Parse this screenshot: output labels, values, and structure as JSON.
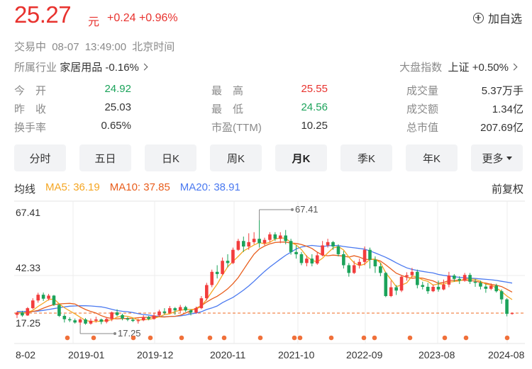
{
  "header": {
    "price": "25.27",
    "unit": "元",
    "change": "+0.24",
    "change_pct": "+0.96%",
    "add_watch": "加自选",
    "status": "交易中",
    "datetime": "08-07 13:49:00",
    "timezone": "北京时间",
    "industry_label": "所属行业",
    "industry_value": "家居用品 -0.16%",
    "market_label": "大盘指数",
    "market_value": "上证 +0.50%"
  },
  "quotes": [
    {
      "label": "今　开",
      "value": "24.92",
      "color": "#1ba35a"
    },
    {
      "label": "昨　收",
      "value": "25.03",
      "color": "#333333"
    },
    {
      "label": "换手率",
      "value": "0.65%",
      "color": "#333333"
    },
    {
      "label": "最　高",
      "value": "25.55",
      "color": "#e8322e"
    },
    {
      "label": "最　低",
      "value": "24.56",
      "color": "#1ba35a"
    },
    {
      "label": "市盈(TTM)",
      "value": "10.25",
      "color": "#333333"
    },
    {
      "label": "成交量",
      "value": "5.37万手",
      "color": "#333333"
    },
    {
      "label": "成交额",
      "value": "1.34亿",
      "color": "#333333"
    },
    {
      "label": "总市值",
      "value": "207.69亿",
      "color": "#333333"
    }
  ],
  "tabs": [
    "分时",
    "五日",
    "日K",
    "周K",
    "月K",
    "季K",
    "年K",
    "更多"
  ],
  "active_tab": "月K",
  "ma": {
    "label": "均线",
    "ma5": "MA5: 36.19",
    "ma10": "MA10: 37.85",
    "ma20": "MA20: 38.91",
    "ma5_color": "#f5a623",
    "ma10_color": "#e85d1c",
    "ma20_color": "#4a79f0"
  },
  "adjust": "前复权",
  "chart_data": {
    "type": "candlestick",
    "y_ticks": [
      "67.41",
      "42.33",
      "17.25"
    ],
    "ylim": [
      17.25,
      67.41
    ],
    "x_ticks": [
      "8-02",
      "2019-01",
      "2019-12",
      "2020-11",
      "2021-10",
      "2022-09",
      "2023-08",
      "2024-08"
    ],
    "max_label": "67.41",
    "min_label": "17.25",
    "last_close": 25.27,
    "up_color": "#f23d3d",
    "down_color": "#1ba35a",
    "candles": [
      [
        24.5,
        25.5,
        23,
        26
      ],
      [
        25.5,
        24.2,
        23.6,
        26.3
      ],
      [
        24.2,
        27.5,
        24,
        28
      ],
      [
        27.5,
        31,
        27,
        32
      ],
      [
        31,
        33.6,
        30,
        34.5
      ],
      [
        33.6,
        31.8,
        30.8,
        34.6
      ],
      [
        31.8,
        33.2,
        31,
        34
      ],
      [
        33.2,
        29,
        28.5,
        33.5
      ],
      [
        29,
        24,
        23.5,
        29.5
      ],
      [
        24,
        22.5,
        21,
        24.8
      ],
      [
        22.5,
        22,
        21.2,
        23.4
      ],
      [
        22,
        21,
        20.5,
        22.8
      ],
      [
        21,
        22.4,
        19.8,
        23
      ],
      [
        22.4,
        20.5,
        20,
        23
      ],
      [
        20.5,
        21.8,
        20,
        22.8
      ],
      [
        21.8,
        22.4,
        21,
        23.6
      ],
      [
        22.4,
        21.3,
        20.2,
        22.8
      ],
      [
        21.3,
        22.6,
        20.6,
        23.4
      ],
      [
        22.6,
        25.6,
        21.6,
        26
      ],
      [
        25.6,
        24.4,
        23.8,
        27
      ],
      [
        24.4,
        22.8,
        22,
        25
      ],
      [
        22.8,
        22.3,
        21.6,
        23.5
      ],
      [
        22.3,
        21.7,
        21.2,
        23
      ],
      [
        21.7,
        22,
        20.5,
        22.8
      ],
      [
        22,
        23.5,
        21.6,
        24.3
      ],
      [
        23.5,
        22.6,
        22,
        24
      ],
      [
        22.6,
        24.2,
        22.3,
        25.5
      ],
      [
        24.2,
        26,
        23.5,
        26.8
      ],
      [
        26,
        25.4,
        24.6,
        27.5
      ],
      [
        25.4,
        27.5,
        25,
        28.5
      ],
      [
        27.5,
        26.5,
        24.5,
        28
      ],
      [
        26.5,
        28,
        25.5,
        29
      ],
      [
        28,
        26.5,
        25.8,
        28.6
      ],
      [
        26.5,
        25.5,
        24.2,
        27
      ],
      [
        25.5,
        27.5,
        25,
        28.2
      ],
      [
        27.5,
        32,
        27,
        33
      ],
      [
        32,
        38,
        31,
        39
      ],
      [
        38,
        44,
        37,
        45
      ],
      [
        44,
        43,
        41,
        47
      ],
      [
        43,
        49,
        42.5,
        50.5
      ],
      [
        49,
        48,
        46,
        52
      ],
      [
        48,
        54,
        47.5,
        55
      ],
      [
        54,
        58,
        53.5,
        59
      ],
      [
        58,
        55.5,
        53,
        60
      ],
      [
        55.5,
        57.5,
        54,
        61.5
      ],
      [
        57.5,
        59,
        56.5,
        62
      ],
      [
        59,
        57,
        55,
        67.41
      ],
      [
        57,
        58.5,
        56,
        59.5
      ],
      [
        58.5,
        61,
        57.5,
        62
      ],
      [
        61,
        59,
        58,
        62
      ],
      [
        59,
        60.5,
        57,
        62
      ],
      [
        60.5,
        58,
        56.5,
        63
      ],
      [
        58,
        53,
        51.8,
        59
      ],
      [
        53,
        52,
        50,
        56
      ],
      [
        52,
        48,
        47,
        53
      ],
      [
        48,
        50,
        46.5,
        51.5
      ],
      [
        50,
        47.8,
        46.5,
        52
      ],
      [
        47.8,
        51.5,
        47.2,
        53
      ],
      [
        51.5,
        56,
        51,
        58
      ],
      [
        56,
        57.5,
        55,
        59
      ],
      [
        57.5,
        55.5,
        54,
        58
      ],
      [
        55.5,
        52,
        51,
        56.5
      ],
      [
        52,
        47,
        45.5,
        53.5
      ],
      [
        47,
        43.5,
        41.8,
        48
      ],
      [
        43.5,
        47,
        43,
        49
      ],
      [
        47,
        48.5,
        45.5,
        50
      ],
      [
        48.5,
        54,
        47,
        55.5
      ],
      [
        54,
        49.5,
        45.5,
        55
      ],
      [
        49.5,
        46.5,
        43.5,
        51
      ],
      [
        46.5,
        43.5,
        42,
        48
      ],
      [
        43.5,
        33,
        32.5,
        44
      ],
      [
        33,
        37,
        32.5,
        40
      ],
      [
        37,
        35.5,
        33.5,
        38
      ],
      [
        35.5,
        41.8,
        34.8,
        42.5
      ],
      [
        41.8,
        42.5,
        40,
        43.8
      ],
      [
        42.5,
        44,
        41.5,
        45.8
      ],
      [
        44,
        38,
        36.5,
        45
      ],
      [
        38,
        37.2,
        36,
        39.5
      ],
      [
        37.2,
        35.2,
        34,
        39
      ],
      [
        35.2,
        37.2,
        34.8,
        38.2
      ],
      [
        37.2,
        36,
        35,
        40
      ],
      [
        36,
        38.2,
        35.6,
        40.5
      ],
      [
        38.2,
        42.3,
        37,
        44
      ],
      [
        42.3,
        40.8,
        39.5,
        43
      ],
      [
        40.8,
        40,
        38.5,
        42
      ],
      [
        40,
        42.6,
        39.5,
        43.5
      ],
      [
        42.6,
        39.5,
        38.5,
        43.5
      ],
      [
        39.5,
        39,
        37.2,
        40.8
      ],
      [
        39,
        37.3,
        36,
        40
      ],
      [
        37.3,
        36.3,
        34.5,
        38.5
      ],
      [
        36.3,
        37.7,
        35.7,
        38.8
      ],
      [
        37.7,
        35.2,
        34.6,
        38.6
      ],
      [
        35.2,
        31.5,
        29.5,
        36
      ],
      [
        31.5,
        24.92,
        23.8,
        32
      ],
      [
        24.92,
        25.27,
        24.56,
        25.55
      ]
    ],
    "ma5_values": [
      25.5,
      25.3,
      25.6,
      26.5,
      28.3,
      29.8,
      31.4,
      31.7,
      29.5,
      27.7,
      26.3,
      24.9,
      23.4,
      21.9,
      21.5,
      21.4,
      21.7,
      21.8,
      22.3,
      23.4,
      24,
      23.8,
      23.1,
      22.1,
      22.3,
      22.4,
      22.9,
      23.6,
      24.6,
      24.9,
      26,
      26.5,
      27,
      26.9,
      27,
      28.5,
      31.5,
      35,
      38.4,
      42.5,
      46.3,
      48.7,
      51,
      53.5,
      54.8,
      56.2,
      57.3,
      56.7,
      57.4,
      58.9,
      59.4,
      59.2,
      57.3,
      56.2,
      54.1,
      51,
      49.2,
      48.5,
      50.2,
      52.6,
      54.8,
      55.5,
      53.9,
      50.7,
      48.1,
      46.8,
      47.5,
      49.7,
      49.8,
      48.1,
      43.6,
      40.5,
      37.3,
      38,
      39,
      42.1,
      41.7,
      40.3,
      39.7,
      38,
      38.5,
      38.4,
      39.3,
      39.6,
      39.9,
      40.8,
      40.7,
      40.6,
      39.7,
      38.4,
      38.1,
      36.6,
      35.1,
      33,
      31.4
    ],
    "ma10_values": [
      25.5,
      25.4,
      25.5,
      26,
      26.5,
      27.5,
      28.4,
      29.1,
      29.4,
      29.6,
      29.7,
      29.4,
      28.1,
      26.9,
      26,
      25.3,
      24.1,
      23.3,
      22.8,
      22.7,
      22.8,
      22.8,
      22.9,
      23.2,
      23.3,
      23.4,
      23.6,
      23.6,
      23.5,
      23.7,
      23.8,
      24.3,
      25.3,
      26.4,
      27.5,
      28.6,
      30.3,
      31.7,
      32.9,
      34.5,
      36.3,
      38.6,
      41.4,
      45,
      48.6,
      52,
      54.4,
      55.7,
      56.7,
      57.3,
      57.5,
      57.5,
      57.1,
      56.9,
      56.4,
      55.6,
      54.6,
      52.9,
      51.6,
      51.3,
      51.6,
      51.4,
      51.1,
      50.7,
      51.3,
      50.7,
      49.7,
      49.6,
      49.7,
      48.9,
      47.2,
      45.3,
      43.4,
      42.4,
      41.5,
      41.1,
      41.3,
      41.1,
      40.5,
      39.9,
      38.8,
      39.2,
      40,
      40.2,
      40.1,
      40.2,
      40,
      39.8,
      39.2,
      38.9,
      38.3,
      37.9,
      37.3,
      36.1,
      34.8
    ],
    "ma20_values": [
      26,
      26,
      26,
      26,
      26.2,
      26.5,
      26.9,
      27.3,
      27.7,
      28.1,
      28.4,
      28.5,
      28.6,
      28.6,
      28.5,
      28.3,
      28.1,
      27.6,
      27,
      26.4,
      26.1,
      25.9,
      25.5,
      25,
      24.6,
      24.4,
      24,
      23.8,
      23.6,
      23.7,
      23.8,
      24,
      24.4,
      24.9,
      25.3,
      25.9,
      26.9,
      27.6,
      28.5,
      30,
      31.2,
      32.4,
      34,
      35.7,
      37.6,
      39.7,
      42,
      44.2,
      46.2,
      48,
      49.8,
      51.5,
      52.9,
      54.4,
      55.3,
      55.7,
      56,
      55.7,
      55.5,
      55.8,
      56,
      55.9,
      55.5,
      55.2,
      54.9,
      54.6,
      54.3,
      53.5,
      52.6,
      51.6,
      50.6,
      49.4,
      48.1,
      46.9,
      45.8,
      45.1,
      44.6,
      44.2,
      43.8,
      43.5,
      42.8,
      42.4,
      42.1,
      41.8,
      41.5,
      41.3,
      41.1,
      41,
      40.8,
      40.6,
      40.4,
      40.1,
      39.7,
      39.3,
      38.9
    ],
    "dividend_markers": 16
  }
}
